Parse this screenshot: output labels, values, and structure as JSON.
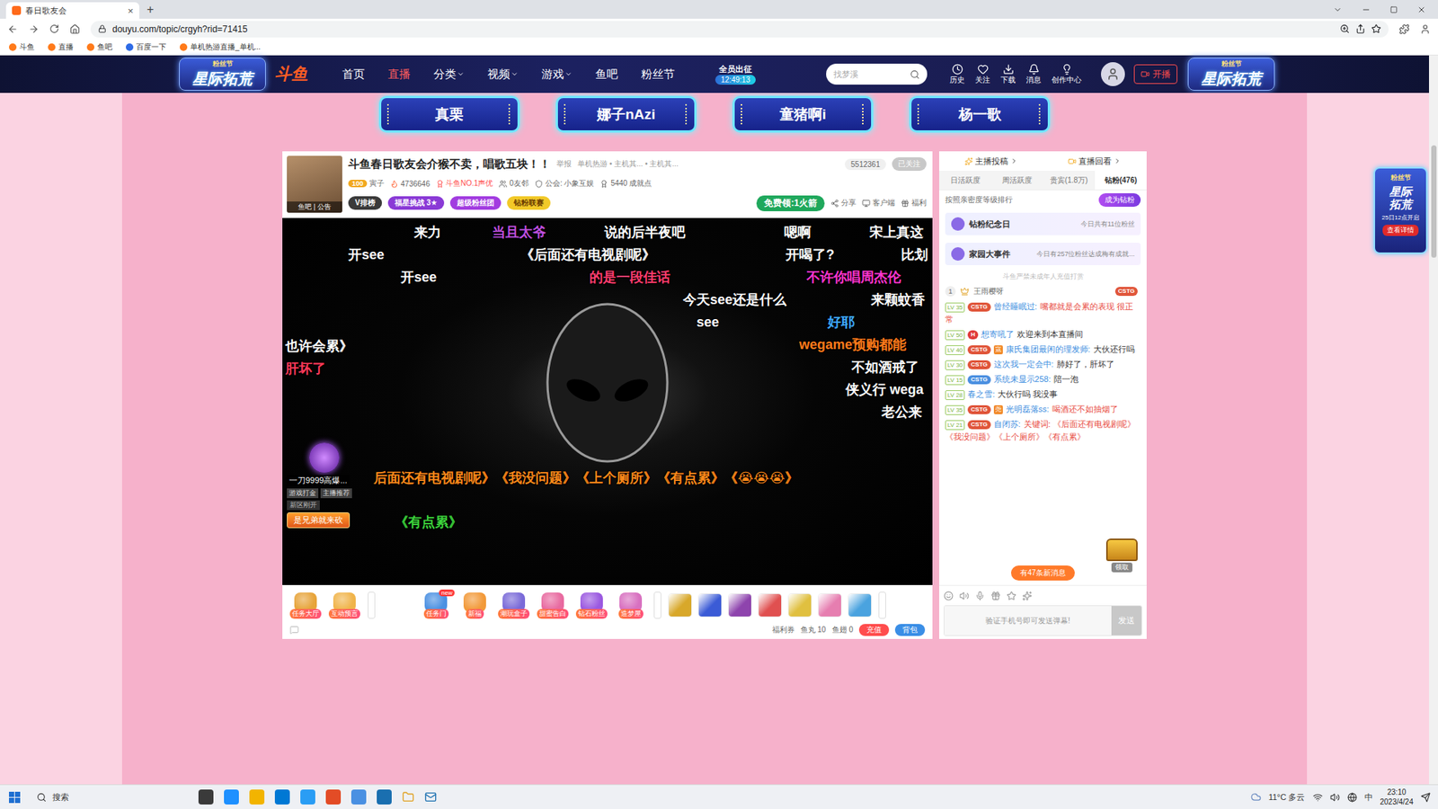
{
  "browser": {
    "tab_title": "春日歌友会",
    "tab_close": "×",
    "new_tab": "+",
    "url": "douyu.com/topic/crgyh?rid=71415",
    "bookmarks": [
      "斗鱼",
      "直播",
      "鱼吧",
      "百度一下",
      "单机热游直播_单机..."
    ]
  },
  "header": {
    "banner_tag": "粉丝节",
    "banner": "星际拓荒",
    "logo": "斗鱼",
    "nav": [
      {
        "label": "首页",
        "selected": false,
        "dropdown": false
      },
      {
        "label": "直播",
        "selected": true,
        "dropdown": false
      },
      {
        "label": "分类",
        "selected": false,
        "dropdown": true
      },
      {
        "label": "视频",
        "selected": false,
        "dropdown": true
      },
      {
        "label": "游戏",
        "selected": false,
        "dropdown": true
      },
      {
        "label": "鱼吧",
        "selected": false,
        "dropdown": false
      },
      {
        "label": "粉丝节",
        "selected": false,
        "dropdown": false
      }
    ],
    "event": {
      "label": "全员出征",
      "timer": "12:49:13"
    },
    "search": {
      "placeholder": "找梦溪"
    },
    "tools": [
      "历史",
      "关注",
      "下载",
      "消息",
      "创作中心"
    ],
    "live_button": "开播"
  },
  "promo": {
    "tag": "粉丝节",
    "title": "星际拓荒",
    "date": "25日12点开启",
    "link": "查看详情"
  },
  "anchor_tabs": [
    "真栗",
    "娜子nAzi",
    "童猪啊i",
    "杨一歌"
  ],
  "room": {
    "title": "斗鱼春日歌友会介猴不卖，唱歌五块！！",
    "report": "举报",
    "category": "单机热游 • 主机其... • 主机其...",
    "room_id": "5512361",
    "follow": "已关注",
    "avatar_links": "鱼吧 | 公告",
    "anchor_level": "100",
    "anchor": "寅子",
    "hot": "4736646",
    "tag": "斗鱼NO.1声优",
    "friends": "0友邻",
    "guild": "公会: 小象互娱",
    "achievement": "5440 成就点",
    "badges": [
      {
        "label": "V排榜",
        "color": "#3a3a3a"
      },
      {
        "label": "福星挑战 3★",
        "color": "#8a3ad6"
      },
      {
        "label": "超级粉丝团",
        "color": "#a23ce0"
      },
      {
        "label": "钻粉联赛",
        "color": "#f2c928"
      }
    ],
    "free_gift": "免费领:1火箭",
    "actions": [
      "分享",
      "客户端",
      "福利"
    ]
  },
  "video": {
    "danmaku": [
      {
        "text": "来力",
        "color": "#ffffff"
      },
      {
        "text": "当且太爷",
        "color": "#c050e0"
      },
      {
        "text": "说的后半夜吧",
        "color": "#ffffff"
      },
      {
        "text": "嗯啊",
        "color": "#ffffff"
      },
      {
        "text": "宋上真这",
        "color": "#ffffff"
      },
      {
        "text": "开see",
        "color": "#ffffff"
      },
      {
        "text": "《后面还有电视剧呢》",
        "color": "#ffffff"
      },
      {
        "text": "开喝了?",
        "color": "#ffffff"
      },
      {
        "text": "比划",
        "color": "#ffffff"
      },
      {
        "text": "开see",
        "color": "#ffffff"
      },
      {
        "text": "的是一段佳话",
        "color": "#ff3d6e"
      },
      {
        "text": "不许你唱周杰伦",
        "color": "#ff35d0"
      },
      {
        "text": "今天see还是什么",
        "color": "#ffffff"
      },
      {
        "text": "来颗蚊香",
        "color": "#ffffff"
      },
      {
        "text": "see",
        "color": "#ffffff"
      },
      {
        "text": "好耶",
        "color": "#3ea8ff"
      },
      {
        "text": "wegame预购都能",
        "color": "#ff7a1a"
      },
      {
        "text": "也许会累》",
        "color": "#ffffff"
      },
      {
        "text": "不如酒戒了",
        "color": "#ffffff"
      },
      {
        "text": "肝坏了",
        "color": "#ff3a5a"
      },
      {
        "text": "侠义行 wega",
        "color": "#ffffff"
      },
      {
        "text": "老公来",
        "color": "#ffffff"
      },
      {
        "text": "后面还有电视剧呢》《我没问题》《上个厕所》《有点累》《😭😭😭》",
        "color": "#ff8a1a"
      },
      {
        "text": "《有点累》",
        "color": "#3cd43c"
      }
    ],
    "ad": {
      "title": "一刀9999高爆...",
      "tags": [
        "游戏打金",
        "主播推荐"
      ],
      "subtitle": "新区刚开",
      "button": "是兄弟就来砍"
    }
  },
  "toolbar": {
    "items": [
      {
        "label": "任务大厅",
        "new": false
      },
      {
        "label": "互动预言",
        "new": false
      },
      {
        "label": "任务门",
        "new": true
      },
      {
        "label": "新福",
        "new": false
      },
      {
        "label": "潮玩盒子",
        "new": false
      },
      {
        "label": "甜蜜告白",
        "new": false
      },
      {
        "label": "钻石粉丝",
        "new": false
      },
      {
        "label": "造梦屋",
        "new": false
      }
    ],
    "new_badge": "new",
    "gifts": [
      {
        "color": "#d8a82a"
      },
      {
        "color": "#3b5bd6"
      },
      {
        "color": "#8e44ad"
      },
      {
        "color": "#e05050"
      },
      {
        "color": "#e0c040"
      },
      {
        "color": "#e67eb0"
      },
      {
        "color": "#4aa3df"
      }
    ],
    "wallet": {
      "coupon": "福利券",
      "yuwan": "鱼丸 10",
      "yuchi": "鱼翅 0",
      "recharge": "充值",
      "backpack": "背包"
    }
  },
  "chat_panel": {
    "links": [
      "主播投稿",
      "直播回看"
    ],
    "tabs": [
      {
        "label": "日活跃度",
        "selected": false
      },
      {
        "label": "周活跃度",
        "selected": false
      },
      {
        "label": "贵宾(1.8万)",
        "selected": false
      },
      {
        "label": "钻粉(476)",
        "selected": true
      }
    ],
    "rank_note": "按照亲密度等级排行",
    "become_fan": "成为钻粉",
    "cards": [
      {
        "title": "钻粉纪念日",
        "detail": "今日共有11位粉丝"
      },
      {
        "title": "家园大事件",
        "detail": "今日有257位粉丝达成梅有成就..."
      }
    ],
    "notice": "斗鱼严禁未成年人充值打赏",
    "top_fan": {
      "rank": "1",
      "name": "王雨樱呀",
      "badge": "CSTG"
    },
    "messages": [
      {
        "level": "LV 35",
        "badge": "CSTG",
        "badge_color": "#e0553a",
        "name": "曾经睡眠过:",
        "text": "嘴都就是会累的表现 很正常",
        "color": "#e8483c"
      },
      {
        "level": "LV 50",
        "badge": "H",
        "badge_color": "#e03a3a",
        "name": "想寄吼了",
        "text": "欢迎来到本直播间",
        "color": "#333333"
      },
      {
        "level": "LV 40",
        "badge": "CSTG",
        "badge_color": "#e0553a",
        "fan_tag": "寇",
        "name": "康氏集团最闲的理发师:",
        "text": "大伙还行吗",
        "color": "#333333"
      },
      {
        "level": "LV 30",
        "badge": "CSTG",
        "badge_color": "#e0553a",
        "name": "这次我一定会中:",
        "text": "肺好了，肝坏了",
        "color": "#333333"
      },
      {
        "level": "LV 15",
        "badge": "CSTG",
        "badge_color": "#4a8fe0",
        "name": "系统未显示258:",
        "text": "陪一泡",
        "color": "#333333"
      },
      {
        "level": "LV 28",
        "name": "春之雪:",
        "text": "大伙行吗 我没事",
        "color": "#333333"
      },
      {
        "level": "LV 35",
        "badge": "CSTG",
        "badge_color": "#e0553a",
        "fan_tag": "尧",
        "name": "光明磊落ss:",
        "text": "喝酒还不如抽烟了",
        "color": "#e8483c"
      },
      {
        "level": "LV 21",
        "badge": "CSTG",
        "badge_color": "#e0553a",
        "name": "自闭苏:",
        "text": "关键词: 《后面还有电视剧呢》《我没问题》《上个厕所》《有点累》",
        "color": "#e8483c"
      }
    ],
    "new_messages": "有47条新消息",
    "treasure": "领取",
    "input_placeholder": "验证手机号即可发送弹幕!",
    "send": "发送"
  },
  "taskbar": {
    "search": "搜索",
    "weather": "11°C 多云",
    "ime": "中",
    "time": "23:10",
    "date": "2023/4/24"
  }
}
